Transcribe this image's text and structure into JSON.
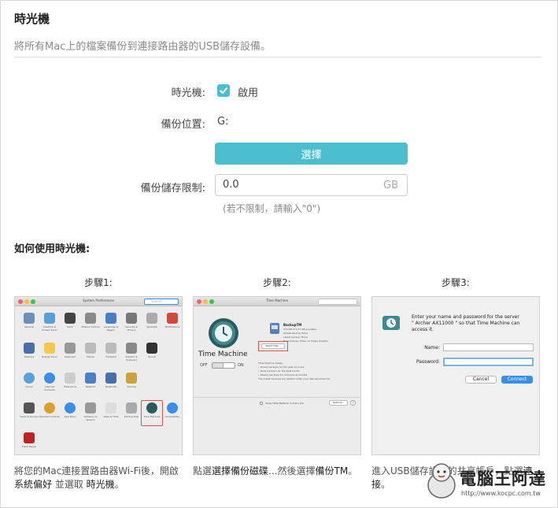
{
  "header": {
    "title": "時光機",
    "description": "將所有Mac上的檔案備份到連接路由器的USB儲存設備。"
  },
  "form": {
    "timemachine_label": "時光機:",
    "enable_label": "啟用",
    "enabled": true,
    "backup_location_label": "備份位置:",
    "backup_location_value": "G:",
    "select_button": "選擇",
    "limit_label": "備份儲存限制:",
    "limit_value": "0.0",
    "limit_unit": "GB",
    "limit_hint": "(若不限制，請輸入\"0\")"
  },
  "howto": {
    "title": "如何使用時光機:",
    "steps": [
      {
        "label": "步驟1:",
        "caption_a": "將您的Mac連接置路由器Wi-Fi後，開啟",
        "caption_b": "系統偏好",
        "caption_c": " 並選取 ",
        "caption_d": "時光機",
        "caption_e": "。"
      },
      {
        "label": "步驟2:",
        "caption_a": "點選",
        "caption_b": "選擇備份磁碟",
        "caption_c": "...然後選擇",
        "caption_d": "備份TM",
        "caption_e": "。"
      },
      {
        "label": "步驟3:",
        "caption_a": "進入USB儲存設備的共享帳戶，點選",
        "caption_b": "連接",
        "caption_c": "。"
      }
    ]
  },
  "screens": {
    "system_prefs": {
      "window_title": "System Preferences",
      "search_placeholder": "Search",
      "items": [
        "General",
        "Desktop & Screen Saver",
        "Dock",
        "Mission Control",
        "Language & Region",
        "Security & Privacy",
        "Spotlight",
        "Notifications",
        "Displays",
        "Energy Saver",
        "Keyboard",
        "Mouse",
        "Trackpad",
        "Printers & Scanners",
        "Sound",
        "iCloud",
        "Internet Accounts",
        "Extensions",
        "Network",
        "Bluetooth",
        "Sharing",
        "Users & Groups",
        "Parental Controls",
        "App Store",
        "Dictation & Speech",
        "Date & Time",
        "Startup Disk",
        "Time Machine",
        "Accessibility",
        "Flash Player"
      ]
    },
    "time_machine": {
      "window_title": "Time Machine",
      "app_title": "Time Machine",
      "off_label": "OFF",
      "on_label": "ON",
      "disk_name": "BackupTM",
      "disk_detail_1": "372 KB of 1.57 GB available",
      "disk_detail_2": "Oldest backup: None",
      "disk_detail_3": "Latest backup: None",
      "disk_detail_4": "Next backup: When on Power Adapter",
      "select_disk_button": "Select Disk...",
      "keeps_title": "Time Machine keeps:",
      "keeps_1": "• Hourly backups for the past 24 hours",
      "keeps_2": "• Daily backups for the past month",
      "keeps_3": "• Weekly backups for all previous months",
      "keeps_4": "The oldest backups are deleted when your disk becomes full.",
      "menu_bar_label": "Show Time Machine in menu bar",
      "options_button": "Options..."
    },
    "connect": {
      "prompt_1": "Enter your name and password for the server",
      "prompt_2": "\" Archer AX11000 \" so that Time Machine can",
      "prompt_3": "access it.",
      "name_label": "Name:",
      "password_label": "Password:",
      "cancel_button": "Cancel",
      "connect_button": "Connect"
    }
  },
  "watermark": {
    "brand": "電腦王阿達",
    "url": "http://www.kocpc.com.tw"
  },
  "colors": {
    "accent": "#4cbfcf",
    "highlight_box": "#d9534f",
    "mac_blue": "#3a8ee6"
  }
}
